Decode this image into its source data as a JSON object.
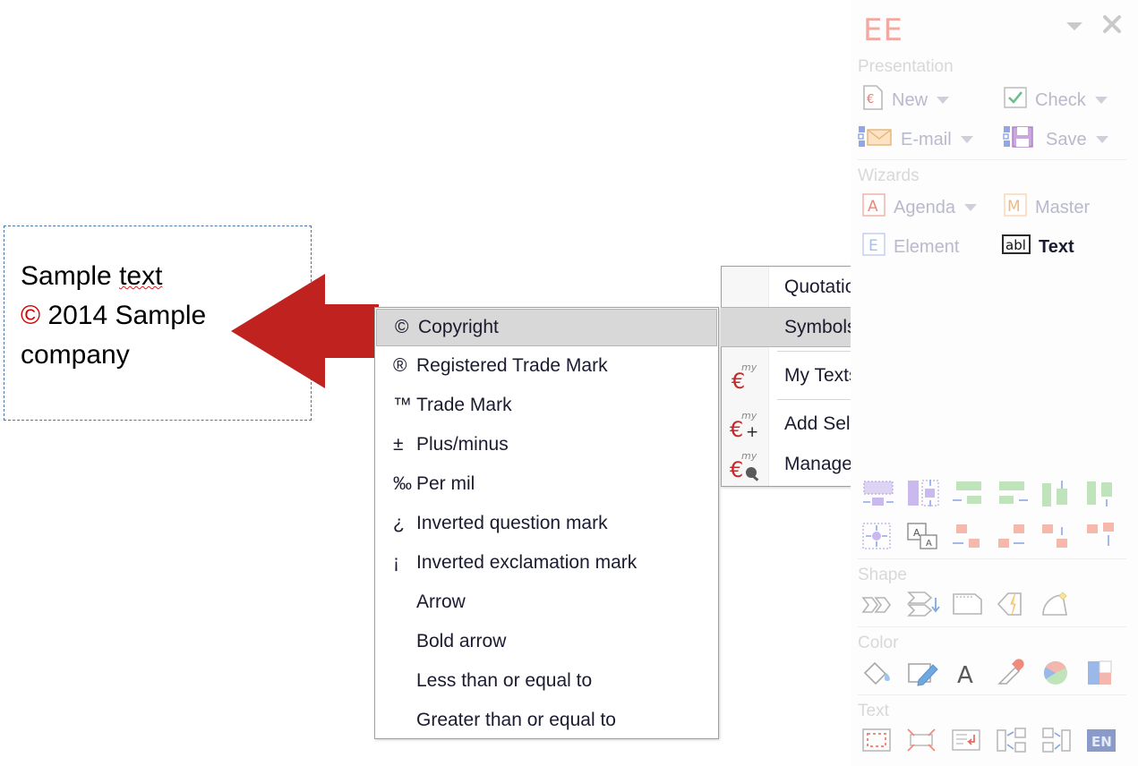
{
  "slide": {
    "textbox": {
      "name": "sample-textbox",
      "line1": "Sample text",
      "line1_misspelled_word": "text",
      "line2_symbol": "©",
      "line2": "2014 Sample",
      "line3": "company"
    },
    "arrow": {
      "name": "left-arrow-shape",
      "color": "#c0231f",
      "direction": "left"
    }
  },
  "symbols_menu": {
    "title": "Symbols",
    "selected_index": 0,
    "items": [
      {
        "glyph": "©",
        "label": "Copyright"
      },
      {
        "glyph": "®",
        "label": "Registered Trade Mark"
      },
      {
        "glyph": "™",
        "label": "Trade Mark"
      },
      {
        "glyph": "±",
        "label": "Plus/minus"
      },
      {
        "glyph": "‰",
        "label": "Per mil"
      },
      {
        "glyph": "¿",
        "label": "Inverted question mark"
      },
      {
        "glyph": "¡",
        "label": "Inverted exclamation mark"
      },
      {
        "glyph": "",
        "label": "Arrow"
      },
      {
        "glyph": "",
        "label": "Bold arrow"
      },
      {
        "glyph": "",
        "label": "Less than or equal to"
      },
      {
        "glyph": "",
        "label": "Greater than or equal to"
      }
    ]
  },
  "context_menu": {
    "items": [
      {
        "label": "Quotations",
        "submenu": true,
        "selected": false,
        "icon": ""
      },
      {
        "label": "Symbols",
        "submenu": true,
        "selected": true,
        "icon": ""
      },
      {
        "label": "My Texts",
        "submenu": true,
        "selected": false,
        "icon": "my-euro-icon"
      },
      {
        "label": "Add Selection to \"My Texts\"...",
        "submenu": false,
        "selected": false,
        "icon": "my-euro-plus-icon"
      },
      {
        "label": "Manage \"My Texts\"...",
        "submenu": false,
        "selected": false,
        "icon": "my-euro-gear-icon"
      }
    ]
  },
  "sidebar": {
    "title": "EE",
    "title_color": "#f4a9a0",
    "collapse_icon": "chevron-down-icon",
    "close_icon": "close-icon",
    "sections": [
      {
        "label": "Presentation",
        "buttons": [
          {
            "label": "New",
            "icon": "new-document-icon",
            "dropdown": true
          },
          {
            "label": "Check",
            "icon": "check-box-icon",
            "dropdown": true
          },
          {
            "label": "E-mail",
            "icon": "email-icon",
            "dropdown": true
          },
          {
            "label": "Save",
            "icon": "save-disk-icon",
            "dropdown": true
          }
        ]
      },
      {
        "label": "Wizards",
        "buttons": [
          {
            "label": "Agenda",
            "icon": "agenda-a-icon",
            "dropdown": true
          },
          {
            "label": "Master",
            "icon": "master-m-icon",
            "dropdown": false
          },
          {
            "label": "Element",
            "icon": "element-e-icon",
            "dropdown": false
          },
          {
            "label": "Text",
            "icon": "abl-text-icon",
            "dropdown": false,
            "active": true
          }
        ]
      },
      {
        "label": "",
        "icons_row1": [
          "align-center-horizontal-icon",
          "align-center-vertical-icon",
          "align-left-icon",
          "align-right-icon",
          "align-top-icon",
          "align-bottom-icon"
        ],
        "icons_row2": [
          "distribute-center-icon",
          "duplicate-object-icon",
          "move-left-icon",
          "move-right-icon",
          "move-up-icon",
          "move-down-icon"
        ]
      },
      {
        "label": "Shape",
        "icons": [
          "merge-shapes-icon",
          "order-shapes-icon",
          "shape-outline-icon",
          "quick-shape-icon",
          "curve-point-icon"
        ]
      },
      {
        "label": "Color",
        "icons": [
          "fill-bucket-icon",
          "edit-pen-icon",
          "font-color-icon",
          "eyedropper-icon",
          "color-wheel-icon",
          "palette-swatch-icon"
        ]
      },
      {
        "label": "Text",
        "icons": [
          "text-frame-icon",
          "fit-text-icon",
          "text-wrap-icon",
          "split-text-icon",
          "merge-text-icon",
          "language-en-icon"
        ],
        "language_badge": "EN"
      }
    ]
  }
}
